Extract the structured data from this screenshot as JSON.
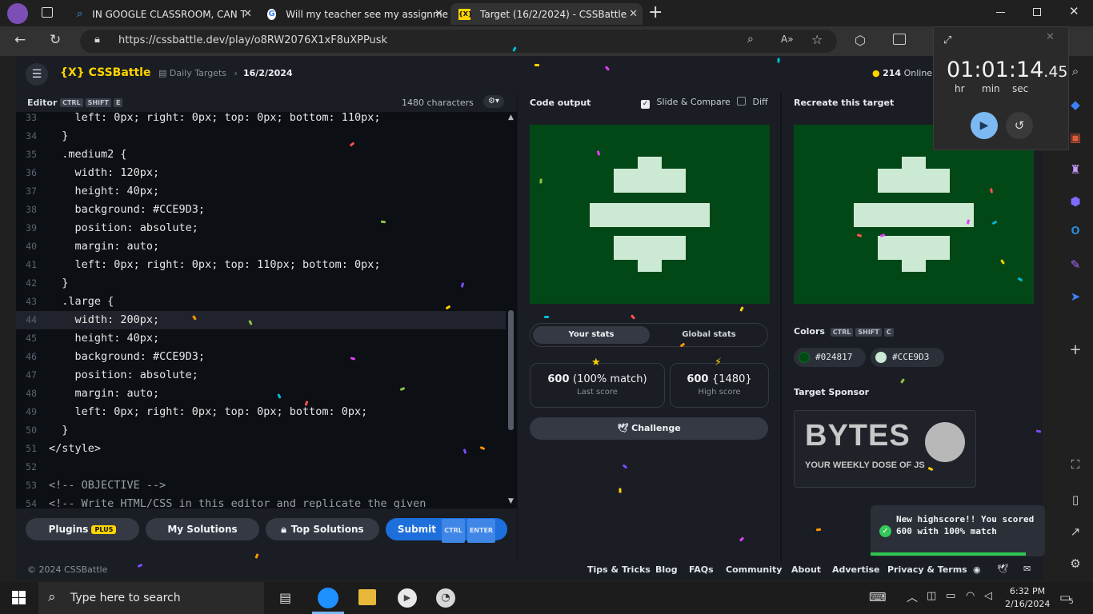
{
  "browser": {
    "tabs": [
      {
        "title": "IN GOOGLE CLASSROOM, CAN T",
        "icon": "search-icon",
        "active": false
      },
      {
        "title": "Will my teacher see my assignme",
        "icon": "google-icon",
        "active": false
      },
      {
        "title": "Target (16/2/2024) - CSSBattle",
        "icon": "cssbattle-icon",
        "active": true
      }
    ],
    "url": "https://cssbattle.dev/play/o8RW2076X1xF8uXPPusk"
  },
  "app": {
    "logo": "{X} CSSBattle",
    "breadcrumb": "Daily Targets",
    "date": "16/2/2024",
    "online_count": "214",
    "online_label": "Online"
  },
  "editor": {
    "label": "Editor",
    "shortcut": [
      "CTRL",
      "SHIFT",
      "E"
    ],
    "char_count": "1480 characters",
    "lines": [
      {
        "n": "33",
        "t": "    left: 0px; right: 0px; top: 0px; bottom: 110px;"
      },
      {
        "n": "34",
        "t": "  }"
      },
      {
        "n": "35",
        "t": "  .medium2 {"
      },
      {
        "n": "36",
        "t": "    width: 120px;"
      },
      {
        "n": "37",
        "t": "    height: 40px;"
      },
      {
        "n": "38",
        "t": "    background: #CCE9D3;"
      },
      {
        "n": "39",
        "t": "    position: absolute;"
      },
      {
        "n": "40",
        "t": "    margin: auto;"
      },
      {
        "n": "41",
        "t": "    left: 0px; right: 0px; top: 110px; bottom: 0px;"
      },
      {
        "n": "42",
        "t": "  }"
      },
      {
        "n": "43",
        "t": "  .large {"
      },
      {
        "n": "44",
        "t": "    width: 200px;"
      },
      {
        "n": "45",
        "t": "    height: 40px;"
      },
      {
        "n": "46",
        "t": "    background: #CCE9D3;"
      },
      {
        "n": "47",
        "t": "    position: absolute;"
      },
      {
        "n": "48",
        "t": "    margin: auto;"
      },
      {
        "n": "49",
        "t": "    left: 0px; right: 0px; top: 0px; bottom: 0px;"
      },
      {
        "n": "50",
        "t": "  }"
      },
      {
        "n": "51",
        "t": "</style>"
      },
      {
        "n": "52",
        "t": ""
      },
      {
        "n": "53",
        "t": "<!-- OBJECTIVE -->"
      },
      {
        "n": "54",
        "t": "<!-- Write HTML/CSS in this editor and replicate the given"
      }
    ],
    "buttons": {
      "plugins": "Plugins",
      "plugins_badge": "PLUS",
      "my_solutions": "My Solutions",
      "top_solutions": "Top Solutions",
      "submit": "Submit",
      "submit_kbd": [
        "CTRL",
        "ENTER"
      ]
    }
  },
  "output": {
    "title": "Code output",
    "slide_compare": "Slide & Compare",
    "diff": "Diff",
    "tabs": [
      "Your stats",
      "Global stats"
    ],
    "last_score": "600",
    "last_match": "(100% match)",
    "last_label": "Last score",
    "high_score": "600",
    "high_chars": "{1480}",
    "high_label": "High score",
    "challenge": "Challenge"
  },
  "target": {
    "title": "Recreate this target",
    "colors_label": "Colors",
    "colors_kbd": [
      "CTRL",
      "SHIFT",
      "C"
    ],
    "colors": [
      "#024817",
      "#CCE9D3"
    ],
    "sponsor_label": "Target Sponsor",
    "sponsor_text": "BYTES",
    "sponsor_tagline": "YOUR WEEKLY DOSE OF JS"
  },
  "timer": {
    "hours": "01",
    "minutes": "01",
    "seconds": "14",
    "fraction": ".45",
    "labels": [
      "hr",
      "min",
      "sec"
    ]
  },
  "toast": {
    "text": "New highscore!! You scored 600 with 100% match"
  },
  "footer": {
    "copyright": "© 2024 CSSBattle",
    "links": [
      "Tips & Tricks",
      "Blog",
      "FAQs",
      "Community",
      "About",
      "Advertise",
      "Privacy & Terms"
    ]
  },
  "taskbar": {
    "search": "Type here to search",
    "time": "6:32 PM",
    "date": "2/16/2024",
    "notif": "5"
  },
  "accent_colors": {
    "yellow": "#ffd400",
    "blue": "#1d6fdc",
    "green": "#024817",
    "mint": "#CCE9D3"
  }
}
